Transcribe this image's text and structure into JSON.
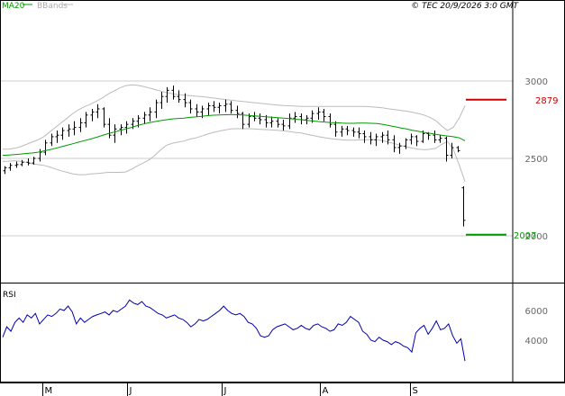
{
  "header": {
    "ma_label": "MA20",
    "bb_label": "BBands",
    "copyright": "© TEC 20/9/2026 3:0 GMT"
  },
  "chart_data": [
    {
      "type": "line",
      "panel": "price",
      "y_ticks": [
        "3000",
        "2500",
        "2000"
      ],
      "ylim": [
        1700,
        3300
      ],
      "x_labels": [
        "M",
        "J",
        "J",
        "A",
        "S"
      ],
      "resistance": {
        "value": 2879,
        "label": "2879",
        "color": "#cc0000"
      },
      "support": {
        "value": 2007,
        "label": "2007",
        "color": "#009900"
      },
      "grid": true,
      "colors": {
        "bars": "#000000",
        "ma": "#009900",
        "bbands": "#bbbbbb"
      },
      "series": [
        {
          "name": "MA20",
          "values": [
            2520,
            2522,
            2525,
            2528,
            2532,
            2535,
            2540,
            2548,
            2556,
            2565,
            2575,
            2585,
            2595,
            2605,
            2615,
            2625,
            2636,
            2648,
            2660,
            2670,
            2680,
            2690,
            2700,
            2712,
            2722,
            2730,
            2738,
            2744,
            2750,
            2755,
            2758,
            2760,
            2765,
            2768,
            2772,
            2776,
            2779,
            2781,
            2782,
            2783,
            2782,
            2780,
            2778,
            2775,
            2772,
            2769,
            2766,
            2763,
            2760,
            2757,
            2753,
            2750,
            2746,
            2742,
            2738,
            2735,
            2732,
            2730,
            2728,
            2727,
            2727,
            2728,
            2728,
            2727,
            2725,
            2720,
            2712,
            2705,
            2697,
            2690,
            2682,
            2675,
            2668,
            2662,
            2655,
            2650,
            2645,
            2640,
            2633,
            2614
          ]
        },
        {
          "name": "BBands",
          "values": []
        }
      ],
      "bollinger_upper": [
        2560,
        2560,
        2565,
        2575,
        2590,
        2605,
        2620,
        2640,
        2670,
        2700,
        2730,
        2760,
        2790,
        2815,
        2835,
        2850,
        2870,
        2890,
        2915,
        2935,
        2955,
        2970,
        2975,
        2972,
        2965,
        2955,
        2945,
        2935,
        2925,
        2918,
        2912,
        2908,
        2905,
        2902,
        2900,
        2895,
        2890,
        2885,
        2880,
        2876,
        2872,
        2868,
        2864,
        2860,
        2856,
        2852,
        2848,
        2845,
        2842,
        2840,
        2838,
        2836,
        2836,
        2836,
        2836,
        2836,
        2836,
        2836,
        2836,
        2836,
        2836,
        2836,
        2836,
        2833,
        2830,
        2826,
        2820,
        2815,
        2810,
        2805,
        2798,
        2790,
        2780,
        2765,
        2745,
        2710,
        2680,
        2700,
        2760,
        2840
      ],
      "bollinger_lower": [
        2480,
        2482,
        2485,
        2482,
        2475,
        2465,
        2460,
        2455,
        2445,
        2432,
        2420,
        2410,
        2400,
        2395,
        2395,
        2400,
        2402,
        2406,
        2410,
        2410,
        2410,
        2412,
        2430,
        2452,
        2470,
        2490,
        2520,
        2555,
        2585,
        2598,
        2605,
        2612,
        2625,
        2632,
        2644,
        2657,
        2668,
        2677,
        2684,
        2690,
        2692,
        2692,
        2692,
        2690,
        2688,
        2686,
        2684,
        2681,
        2678,
        2674,
        2668,
        2664,
        2656,
        2648,
        2640,
        2634,
        2628,
        2624,
        2620,
        2618,
        2618,
        2620,
        2620,
        2622,
        2620,
        2614,
        2604,
        2595,
        2584,
        2575,
        2566,
        2560,
        2556,
        2559,
        2565,
        2590,
        2610,
        2560,
        2460,
        2350
      ],
      "ohlc_bars": [
        [
          2420,
          2450,
          2400,
          2440
        ],
        [
          2440,
          2470,
          2420,
          2455
        ],
        [
          2455,
          2480,
          2440,
          2460
        ],
        [
          2460,
          2490,
          2450,
          2475
        ],
        [
          2475,
          2500,
          2455,
          2470
        ],
        [
          2470,
          2510,
          2460,
          2500
        ],
        [
          2500,
          2560,
          2480,
          2540
        ],
        [
          2540,
          2620,
          2520,
          2600
        ],
        [
          2600,
          2660,
          2580,
          2640
        ],
        [
          2640,
          2680,
          2600,
          2650
        ],
        [
          2650,
          2700,
          2620,
          2680
        ],
        [
          2680,
          2720,
          2640,
          2690
        ],
        [
          2690,
          2740,
          2650,
          2700
        ],
        [
          2700,
          2760,
          2670,
          2730
        ],
        [
          2730,
          2800,
          2700,
          2780
        ],
        [
          2780,
          2820,
          2740,
          2800
        ],
        [
          2800,
          2850,
          2760,
          2820
        ],
        [
          2820,
          2830,
          2700,
          2720
        ],
        [
          2720,
          2760,
          2630,
          2650
        ],
        [
          2650,
          2720,
          2600,
          2690
        ],
        [
          2690,
          2720,
          2650,
          2700
        ],
        [
          2700,
          2740,
          2660,
          2720
        ],
        [
          2720,
          2760,
          2690,
          2740
        ],
        [
          2740,
          2780,
          2700,
          2760
        ],
        [
          2760,
          2800,
          2720,
          2780
        ],
        [
          2780,
          2830,
          2740,
          2800
        ],
        [
          2800,
          2880,
          2760,
          2860
        ],
        [
          2860,
          2930,
          2820,
          2900
        ],
        [
          2900,
          2960,
          2860,
          2940
        ],
        [
          2940,
          2970,
          2880,
          2900
        ],
        [
          2900,
          2940,
          2860,
          2880
        ],
        [
          2880,
          2920,
          2830,
          2860
        ],
        [
          2860,
          2880,
          2790,
          2820
        ],
        [
          2820,
          2850,
          2770,
          2800
        ],
        [
          2800,
          2840,
          2760,
          2820
        ],
        [
          2820,
          2860,
          2780,
          2840
        ],
        [
          2840,
          2870,
          2800,
          2830
        ],
        [
          2830,
          2860,
          2790,
          2840
        ],
        [
          2840,
          2880,
          2800,
          2850
        ],
        [
          2850,
          2870,
          2790,
          2810
        ],
        [
          2810,
          2840,
          2760,
          2790
        ],
        [
          2790,
          2800,
          2690,
          2720
        ],
        [
          2720,
          2790,
          2700,
          2770
        ],
        [
          2770,
          2800,
          2740,
          2760
        ],
        [
          2760,
          2790,
          2720,
          2750
        ],
        [
          2750,
          2780,
          2700,
          2730
        ],
        [
          2730,
          2770,
          2700,
          2740
        ],
        [
          2740,
          2760,
          2700,
          2720
        ],
        [
          2720,
          2750,
          2680,
          2710
        ],
        [
          2710,
          2790,
          2690,
          2760
        ],
        [
          2760,
          2800,
          2730,
          2770
        ],
        [
          2770,
          2790,
          2720,
          2750
        ],
        [
          2750,
          2780,
          2720,
          2760
        ],
        [
          2760,
          2810,
          2730,
          2790
        ],
        [
          2790,
          2830,
          2750,
          2800
        ],
        [
          2800,
          2820,
          2740,
          2770
        ],
        [
          2770,
          2790,
          2700,
          2720
        ],
        [
          2720,
          2740,
          2640,
          2670
        ],
        [
          2670,
          2710,
          2640,
          2690
        ],
        [
          2690,
          2710,
          2650,
          2680
        ],
        [
          2680,
          2700,
          2640,
          2670
        ],
        [
          2670,
          2700,
          2630,
          2660
        ],
        [
          2660,
          2680,
          2600,
          2640
        ],
        [
          2640,
          2670,
          2590,
          2620
        ],
        [
          2620,
          2660,
          2580,
          2640
        ],
        [
          2640,
          2670,
          2600,
          2650
        ],
        [
          2650,
          2680,
          2590,
          2620
        ],
        [
          2620,
          2650,
          2540,
          2570
        ],
        [
          2570,
          2600,
          2530,
          2580
        ],
        [
          2580,
          2630,
          2560,
          2620
        ],
        [
          2620,
          2660,
          2590,
          2640
        ],
        [
          2640,
          2650,
          2580,
          2610
        ],
        [
          2610,
          2680,
          2600,
          2660
        ],
        [
          2660,
          2670,
          2620,
          2650
        ],
        [
          2650,
          2680,
          2600,
          2620
        ],
        [
          2620,
          2650,
          2600,
          2630
        ],
        [
          2630,
          2640,
          2480,
          2520
        ],
        [
          2520,
          2600,
          2500,
          2570
        ],
        [
          2570,
          2580,
          2540,
          2550
        ],
        [
          2310,
          2320,
          2060,
          2100
        ]
      ]
    },
    {
      "type": "line",
      "panel": "RSI",
      "title": "RSI",
      "y_ticks": [
        "6000",
        "4000"
      ],
      "ylim": [
        2000,
        7500
      ],
      "color": "#0000aa",
      "values": [
        4200,
        4900,
        4600,
        5200,
        5500,
        5200,
        5700,
        5500,
        5800,
        5100,
        5400,
        5700,
        5600,
        5800,
        6100,
        6000,
        6300,
        5900,
        5100,
        5500,
        5200,
        5400,
        5600,
        5700,
        5800,
        5900,
        5700,
        6000,
        5900,
        6100,
        6300,
        6700,
        6500,
        6400,
        6600,
        6300,
        6200,
        6000,
        5800,
        5700,
        5500,
        5600,
        5700,
        5500,
        5400,
        5200,
        4900,
        5100,
        5400,
        5300,
        5400,
        5600,
        5800,
        6000,
        6300,
        6000,
        5800,
        5700,
        5800,
        5600,
        5200,
        5100,
        4800,
        4300,
        4200,
        4300,
        4700,
        4900,
        5000,
        5100,
        4900,
        4700,
        4800,
        5000,
        4800,
        4700,
        5000,
        5100,
        4900,
        4800,
        4600,
        4700,
        5100,
        5000,
        5200,
        5600,
        5400,
        5200,
        4600,
        4400,
        4000,
        3900,
        4200,
        4000,
        3900,
        3700,
        3900,
        3800,
        3600,
        3500,
        3200,
        4500,
        4800,
        5000,
        4400,
        4800,
        5300,
        4700,
        4800,
        5100,
        4300,
        3800,
        4100,
        2600
      ]
    }
  ]
}
